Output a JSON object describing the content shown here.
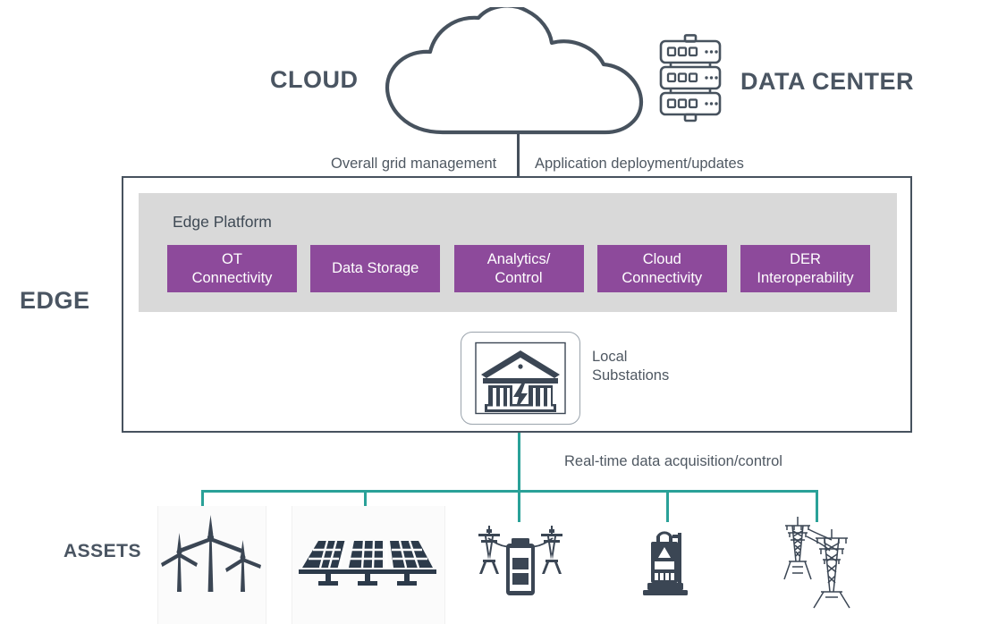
{
  "tiers": {
    "cloud_label": "CLOUD",
    "data_center_label": "DATA CENTER",
    "edge_label": "EDGE",
    "assets_label": "ASSETS"
  },
  "connectors": {
    "cloud_to_edge_left": "Overall grid management",
    "cloud_to_edge_right": "Application deployment/updates",
    "edge_to_assets": "Real-time data acquisition/control"
  },
  "edge": {
    "platform_title": "Edge Platform",
    "capabilities": [
      {
        "label": "OT\nConnectivity"
      },
      {
        "label": "Data Storage"
      },
      {
        "label": "Analytics/\nControl"
      },
      {
        "label": "Cloud\nConnectivity"
      },
      {
        "label": "DER\nInteroperability"
      }
    ],
    "substation_label": "Local\nSubstations"
  },
  "assets": [
    {
      "name": "wind-turbines"
    },
    {
      "name": "solar-panels"
    },
    {
      "name": "battery-storage"
    },
    {
      "name": "ev-charger"
    },
    {
      "name": "transmission-towers"
    }
  ],
  "colors": {
    "dark_slate": "#454f5b",
    "purple": "#8d4a9b",
    "teal": "#2aa198",
    "panel_grey": "#d9d9d9",
    "icon_navy": "#3b4654"
  }
}
